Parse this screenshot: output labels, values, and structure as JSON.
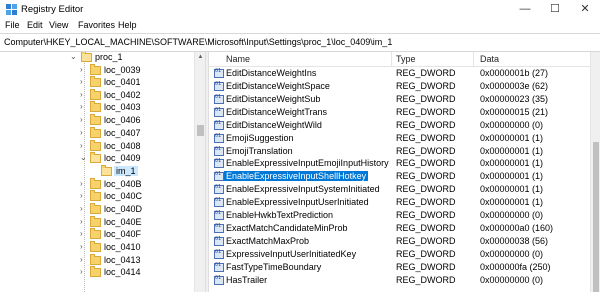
{
  "window": {
    "title": "Registry Editor",
    "minimize": "—",
    "maximize": "☐",
    "close": "✕"
  },
  "menu": [
    "File",
    "Edit",
    "View",
    "Favorites",
    "Help"
  ],
  "address": "Computer\\HKEY_LOCAL_MACHINE\\SOFTWARE\\Microsoft\\Input\\Settings\\proc_1\\loc_0409\\im_1",
  "tree": {
    "items": [
      {
        "label": "proc_1",
        "level": 0,
        "expanded": true
      },
      {
        "label": "loc_0039",
        "level": 1
      },
      {
        "label": "loc_0401",
        "level": 1
      },
      {
        "label": "loc_0402",
        "level": 1
      },
      {
        "label": "loc_0403",
        "level": 1
      },
      {
        "label": "loc_0406",
        "level": 1
      },
      {
        "label": "loc_0407",
        "level": 1
      },
      {
        "label": "loc_0408",
        "level": 1
      },
      {
        "label": "loc_0409",
        "level": 1,
        "expanded": true
      },
      {
        "label": "im_1",
        "level": 2,
        "selected": true
      },
      {
        "label": "loc_040B",
        "level": 1
      },
      {
        "label": "loc_040C",
        "level": 1
      },
      {
        "label": "loc_040D",
        "level": 1
      },
      {
        "label": "loc_040E",
        "level": 1
      },
      {
        "label": "loc_040F",
        "level": 1
      },
      {
        "label": "loc_0410",
        "level": 1
      },
      {
        "label": "loc_0413",
        "level": 1
      },
      {
        "label": "loc_0414",
        "level": 1
      }
    ]
  },
  "list": {
    "headers": {
      "name": "Name",
      "type": "Type",
      "data": "Data"
    },
    "rows": [
      {
        "name": "EditDistanceWeightIns",
        "type": "REG_DWORD",
        "data": "0x0000001b (27)"
      },
      {
        "name": "EditDistanceWeightSpace",
        "type": "REG_DWORD",
        "data": "0x0000003e (62)"
      },
      {
        "name": "EditDistanceWeightSub",
        "type": "REG_DWORD",
        "data": "0x00000023 (35)"
      },
      {
        "name": "EditDistanceWeightTrans",
        "type": "REG_DWORD",
        "data": "0x00000015 (21)"
      },
      {
        "name": "EditDistanceWeightWild",
        "type": "REG_DWORD",
        "data": "0x00000000 (0)"
      },
      {
        "name": "EmojiSuggestion",
        "type": "REG_DWORD",
        "data": "0x00000001 (1)"
      },
      {
        "name": "EmojiTranslation",
        "type": "REG_DWORD",
        "data": "0x00000001 (1)"
      },
      {
        "name": "EnableExpressiveInputEmojiInputHistory",
        "type": "REG_DWORD",
        "data": "0x00000001 (1)"
      },
      {
        "name": "EnableExpressiveInputShellHotkey",
        "type": "REG_DWORD",
        "data": "0x00000001 (1)",
        "selected": true
      },
      {
        "name": "EnableExpressiveInputSystemInitiated",
        "type": "REG_DWORD",
        "data": "0x00000001 (1)"
      },
      {
        "name": "EnableExpressiveInputUserInitiated",
        "type": "REG_DWORD",
        "data": "0x00000001 (1)"
      },
      {
        "name": "EnableHwkbTextPrediction",
        "type": "REG_DWORD",
        "data": "0x00000000 (0)"
      },
      {
        "name": "ExactMatchCandidateMinProb",
        "type": "REG_DWORD",
        "data": "0x000000a0 (160)"
      },
      {
        "name": "ExactMatchMaxProb",
        "type": "REG_DWORD",
        "data": "0x00000038 (56)"
      },
      {
        "name": "ExpressiveInputUserInitiatedKey",
        "type": "REG_DWORD",
        "data": "0x00000000 (0)"
      },
      {
        "name": "FastTypeTimeBoundary",
        "type": "REG_DWORD",
        "data": "0x000000fa (250)"
      },
      {
        "name": "HasTrailer",
        "type": "REG_DWORD",
        "data": "0x00000000 (0)"
      }
    ]
  }
}
